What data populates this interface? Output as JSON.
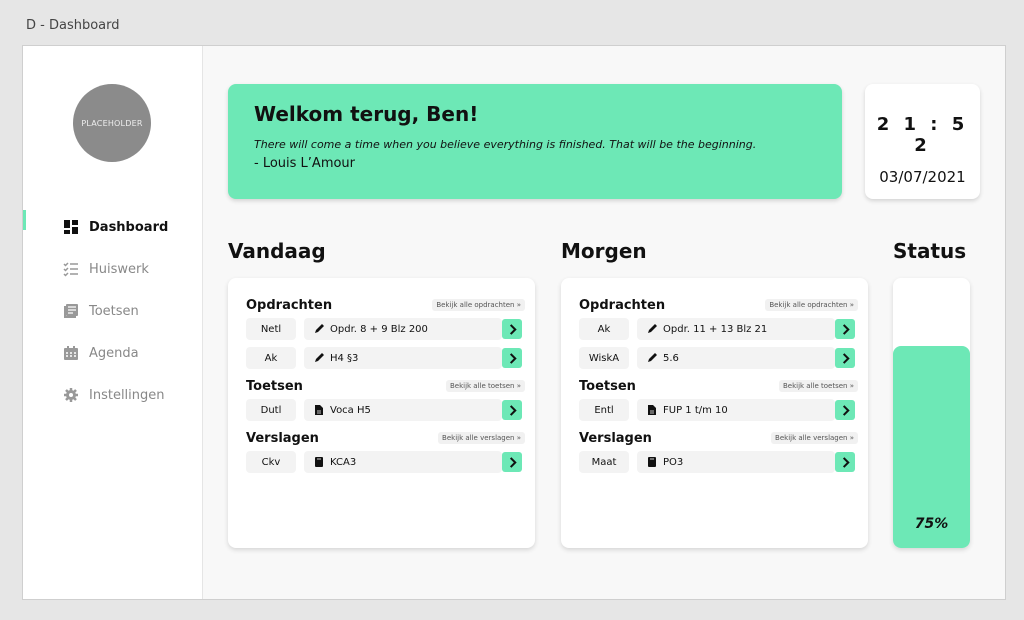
{
  "window": {
    "title": "D - Dashboard"
  },
  "sidebar": {
    "avatar_text": "PLACEHOLDER",
    "items": [
      {
        "label": "Dashboard",
        "icon": "dashboard-icon",
        "active": true
      },
      {
        "label": "Huiswerk",
        "icon": "checklist-icon",
        "active": false
      },
      {
        "label": "Toetsen",
        "icon": "notes-icon",
        "active": false
      },
      {
        "label": "Agenda",
        "icon": "calendar-icon",
        "active": false
      },
      {
        "label": "Instellingen",
        "icon": "gear-icon",
        "active": false
      }
    ]
  },
  "welcome": {
    "title": "Welkom terug, Ben!",
    "quote": "There will come a time when you believe everything is finished. That will be the beginning.",
    "author": "- Louis L’Amour"
  },
  "clock": {
    "time": "2 1 : 5 2",
    "date": "03/07/2021"
  },
  "today": {
    "title": "Vandaag",
    "sections": [
      {
        "title": "Opdrachten",
        "see_all": "Bekijk alle opdrachten »",
        "rows": [
          {
            "subject": "Netl",
            "task": "Opdr. 8 + 9 Blz 200",
            "icon": "pencil-icon"
          },
          {
            "subject": "Ak",
            "task": "H4 §3",
            "icon": "pencil-icon"
          }
        ]
      },
      {
        "title": "Toetsen",
        "see_all": "Bekijk alle toetsen »",
        "rows": [
          {
            "subject": "Dutl",
            "task": "Voca H5",
            "icon": "document-icon"
          }
        ]
      },
      {
        "title": "Verslagen",
        "see_all": "Bekijk alle verslagen »",
        "rows": [
          {
            "subject": "Ckv",
            "task": "KCA3",
            "icon": "book-icon"
          }
        ]
      }
    ]
  },
  "tomorrow": {
    "title": "Morgen",
    "sections": [
      {
        "title": "Opdrachten",
        "see_all": "Bekijk alle opdrachten »",
        "rows": [
          {
            "subject": "Ak",
            "task": "Opdr. 11 + 13 Blz 21",
            "icon": "pencil-icon"
          },
          {
            "subject": "WiskA",
            "task": "5.6",
            "icon": "pencil-icon"
          }
        ]
      },
      {
        "title": "Toetsen",
        "see_all": "Bekijk alle toetsen »",
        "rows": [
          {
            "subject": "Entl",
            "task": "FUP 1 t/m 10",
            "icon": "document-icon"
          }
        ]
      },
      {
        "title": "Verslagen",
        "see_all": "Bekijk alle verslagen »",
        "rows": [
          {
            "subject": "Maat",
            "task": "PO3",
            "icon": "book-icon"
          }
        ]
      }
    ]
  },
  "status": {
    "title": "Status",
    "percent": 75,
    "label": "75%"
  },
  "colors": {
    "accent": "#6de8b6",
    "background": "#f8f8f8",
    "avatar": "#8b8b8b"
  }
}
